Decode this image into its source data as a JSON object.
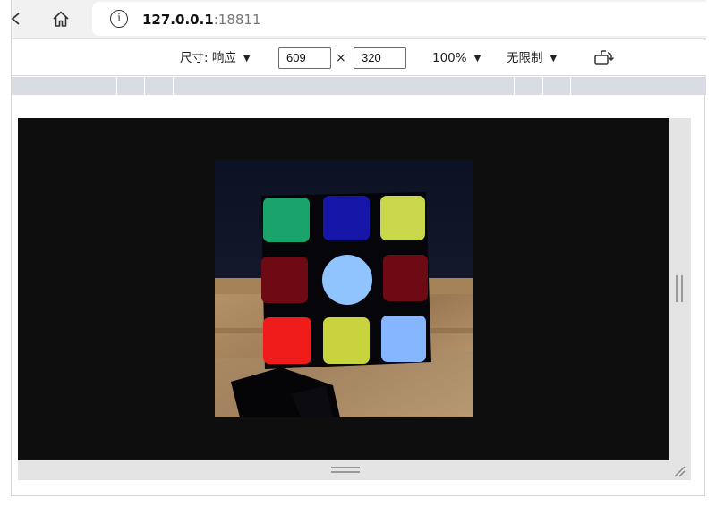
{
  "browser": {
    "url_host": "127.0.0.1",
    "url_port": ":18811",
    "icons": {
      "back": "chevron-left-icon",
      "home": "home-icon",
      "info": "info-icon"
    }
  },
  "device_toolbar": {
    "dimensions_label": "尺寸: 响应",
    "width_value": "609",
    "height_value": "320",
    "times_symbol": "×",
    "zoom_label": "100%",
    "throttle_label": "无限制",
    "dropdown_arrow": "▼",
    "rotate_icon": "rotate-device-icon"
  },
  "viewport": {
    "background": "#0e0e0e",
    "image_subject": "rubik-cube-face",
    "cube_colors": [
      "#1aa36b",
      "#1616a8",
      "#c8d84a",
      "#6e0a14",
      "#8fc4ff",
      "#6e0a14",
      "#f01b1b",
      "#c9d33e",
      "#86b6ff"
    ]
  }
}
